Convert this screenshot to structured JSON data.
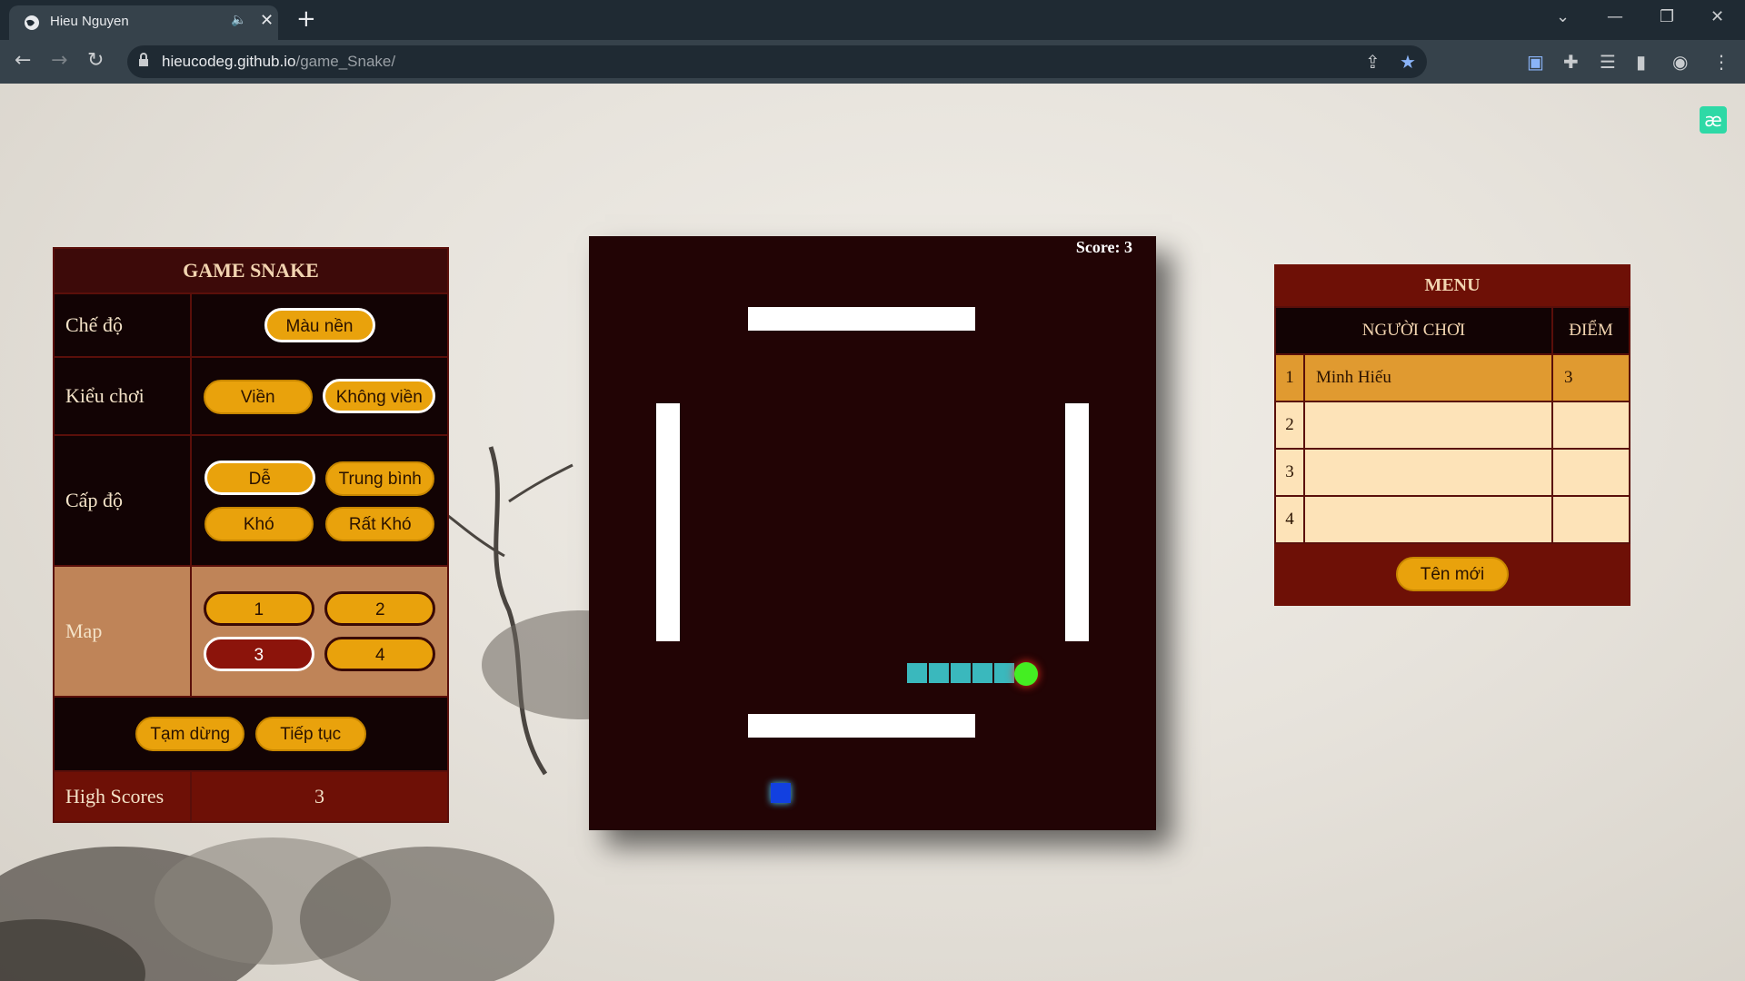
{
  "browser": {
    "tab_title": "Hieu Nguyen",
    "url_host": "hieucodeg.github.io",
    "url_path": "/game_Snake/"
  },
  "left_panel": {
    "title": "GAME SNAKE",
    "mode_label": "Chế độ",
    "mode_button": "Màu nền",
    "style_label": "Kiểu chơi",
    "style_buttons": [
      "Viền",
      "Không viền"
    ],
    "level_label": "Cấp độ",
    "level_buttons": [
      "Dễ",
      "Trung bình",
      "Khó",
      "Rất Khó"
    ],
    "map_label": "Map",
    "map_buttons": [
      "1",
      "2",
      "3",
      "4"
    ],
    "pause_button": "Tạm dừng",
    "resume_button": "Tiếp tục",
    "high_scores_label": "High Scores",
    "high_scores_value": "3"
  },
  "game": {
    "score_text": "Score: 3"
  },
  "menu": {
    "title": "MENU",
    "col_player": "NGƯỜI CHƠI",
    "col_score": "ĐIỂM",
    "rows": [
      {
        "rank": "1",
        "name": "Minh Hiếu",
        "score": "3"
      },
      {
        "rank": "2",
        "name": "",
        "score": ""
      },
      {
        "rank": "3",
        "name": "",
        "score": ""
      },
      {
        "rank": "4",
        "name": "",
        "score": ""
      }
    ],
    "new_name_button": "Tên mới"
  },
  "colors": {
    "panel_dark": "#120304",
    "panel_red": "#6e1006",
    "button_gold": "#e9a20c",
    "map_bg": "#bf8458",
    "snake_body": "#3ab8bd",
    "snake_head": "#44ee22",
    "food": "#1240e0"
  }
}
